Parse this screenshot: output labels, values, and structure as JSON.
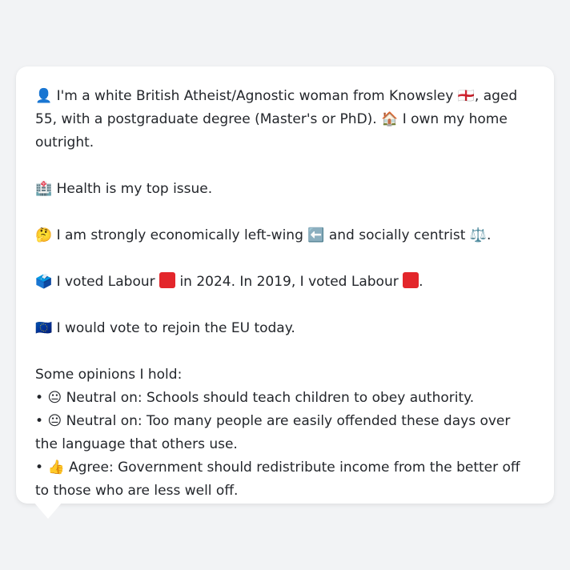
{
  "profile": {
    "line1_icon": "👤",
    "line1_a": "I'm a white British Atheist/Agnostic woman from Knowsley",
    "line1_flag": "🏴󠁧󠁢󠁥󠁮󠁧󠁿",
    "line1_b": ", aged 55, with a postgraduate degree (Master's or PhD).",
    "home_icon": "🏠",
    "home_text": "I own my home outright.",
    "health_icon": "🏥",
    "health_text": "Health is my top issue.",
    "thinking_icon": "🤔",
    "politics_a": "I am strongly economically left-wing",
    "left_arrow_icon": "⬅️",
    "politics_b": "and socially centrist",
    "scales_icon": "⚖️",
    "vote_icon": "🗳️",
    "vote_a": "I voted Labour",
    "vote_b": "in 2024. In 2019, I voted Labour",
    "eu_icon": "🇪🇺",
    "eu_text": "I would vote to rejoin the EU today.",
    "opinions_heading": "Some opinions I hold:",
    "opinions": [
      {
        "bullet": "•",
        "icon": "😐",
        "text": "Neutral on: Schools should teach children to obey authority."
      },
      {
        "bullet": "•",
        "icon": "😐",
        "text": "Neutral on: Too many people are easily offended these days over the language that others use."
      },
      {
        "bullet": "•",
        "icon": "👍",
        "text": "Agree: Government should redistribute income from the better off to those who are less well off."
      }
    ]
  }
}
